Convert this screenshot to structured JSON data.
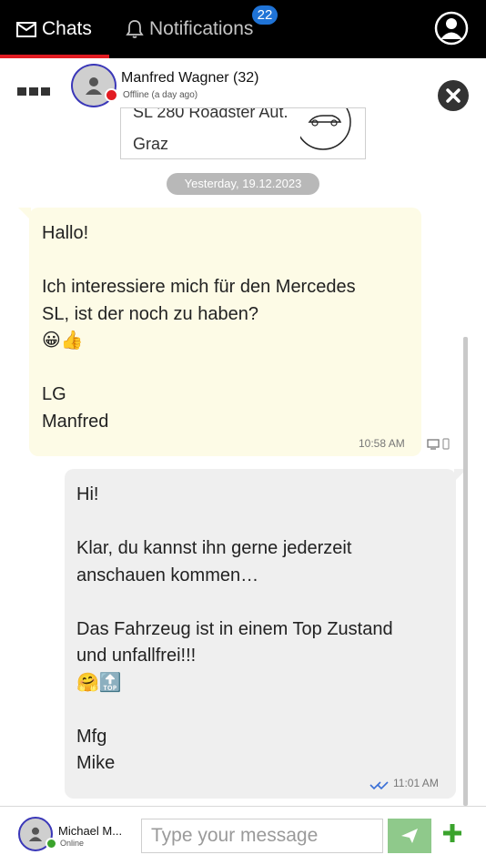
{
  "topbar": {
    "tabs": [
      {
        "label": "Chats",
        "icon": "envelope-icon",
        "active": true
      },
      {
        "label": "Notifications",
        "icon": "bell-icon",
        "active": false
      }
    ],
    "notification_count": "22"
  },
  "chat_header": {
    "contact_name": "Manfred Wagner (32)",
    "contact_status": "Offline (a day ago)"
  },
  "listing": {
    "title": "SL 280 Roadster Aut.",
    "location": "Graz"
  },
  "date_separator": "Yesterday, 19.12.2023",
  "messages": [
    {
      "direction": "incoming",
      "lines": [
        "Hallo!",
        "",
        "Ich interessiere mich für den Mercedes",
        "SL, ist der noch zu haben?",
        "😀👍",
        "",
        "LG",
        "Manfred"
      ],
      "time": "10:58 AM"
    },
    {
      "direction": "outgoing",
      "lines": [
        "Hi!",
        "",
        "Klar, du kannst ihn gerne jederzeit",
        "anschauen kommen…",
        "",
        "Das Fahrzeug ist in einem Top Zustand",
        "und unfallfrei!!!",
        "🤗🔝",
        "",
        "Mfg",
        "Mike"
      ],
      "time": "11:01 AM"
    }
  ],
  "composer": {
    "user_name": "Michael M...",
    "user_status": "Online",
    "placeholder": "Type your message"
  },
  "colors": {
    "topbar_bg": "#000000",
    "active_tab_underline": "#e21b22",
    "badge": "#1f73d6",
    "incoming_bubble": "#fdfbe6",
    "outgoing_bubble": "#efefef",
    "send_button": "#8fc98b",
    "add_button": "#3aa32c",
    "offline_dot": "#e21b22",
    "online_dot": "#3aa32c",
    "read_ticks": "#3a6fd6"
  }
}
